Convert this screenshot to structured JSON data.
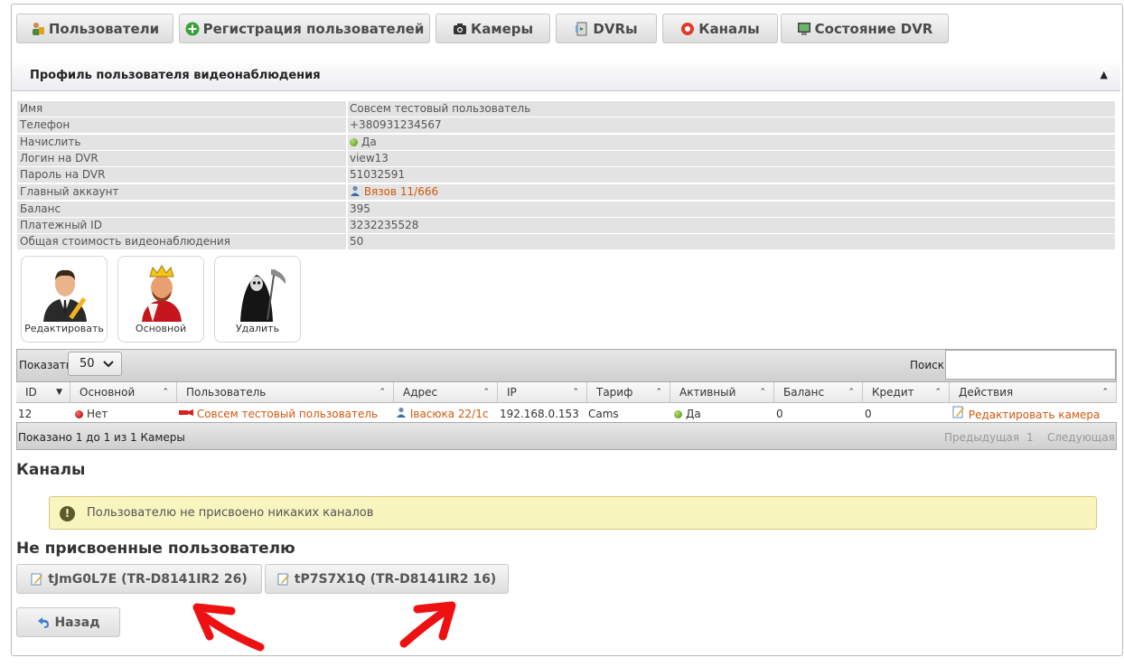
{
  "nav": {
    "users": "Пользователи",
    "register": "Регистрация пользователей",
    "cameras": "Камеры",
    "dvrs": "DVRы",
    "channels": "Каналы",
    "dvr_state": "Состояние DVR"
  },
  "panel": {
    "title": "Профиль пользователя видеонаблюдения",
    "collapse_glyph": "▲"
  },
  "profile": [
    {
      "k": "Имя",
      "v": "Совсем тестовый пользователь"
    },
    {
      "k": "Телефон",
      "v": "+380931234567"
    },
    {
      "k": "Начислить",
      "v": "Да"
    },
    {
      "k": "Логин на DVR",
      "v": "view13"
    },
    {
      "k": "Пароль на DVR",
      "v": "51032591"
    },
    {
      "k": "Главный аккаунт",
      "v": "Вязов 11/666"
    },
    {
      "k": "Баланс",
      "v": "395"
    },
    {
      "k": "Платежный ID",
      "v": "3232235528"
    },
    {
      "k": "Общая стоимость видеонаблюдения",
      "v": "50"
    }
  ],
  "actions": {
    "edit": "Редактировать",
    "main": "Основной",
    "delete": "Удалить"
  },
  "table": {
    "show_label": "Показать",
    "page_size": "50",
    "search_label": "Поиск",
    "columns": [
      "ID",
      "Основной",
      "Пользователь",
      "Адрес",
      "IP",
      "Тариф",
      "Активный",
      "Баланс",
      "Кредит",
      "Действия"
    ],
    "row": {
      "id": "12",
      "main": "Нет",
      "user": "Совсем тестовый пользователь",
      "address": "Івасюка 22/1с",
      "ip": "192.168.0.153",
      "tariff": "Cams",
      "active": "Да",
      "balance": "0",
      "credit": "0",
      "action": "Редактировать камера"
    },
    "info": "Показано 1 до 1 из 1 Камеры",
    "prev": "Предыдущая",
    "page": "1",
    "next": "Следующая"
  },
  "channels": {
    "title": "Каналы",
    "alert": "Пользователю не присвоено никаких каналов",
    "unassigned_title": "Не присвоенные пользователю",
    "buttons": [
      "tJmG0L7E (TR-D8141IR2 26)",
      "tP7S7X1Q (TR-D8141IR2 16)"
    ]
  },
  "back": "Назад",
  "colors": {
    "link": "#d2570e",
    "green": "#5c9e1a",
    "red": "#b01010",
    "arrow": "#ee1111"
  }
}
